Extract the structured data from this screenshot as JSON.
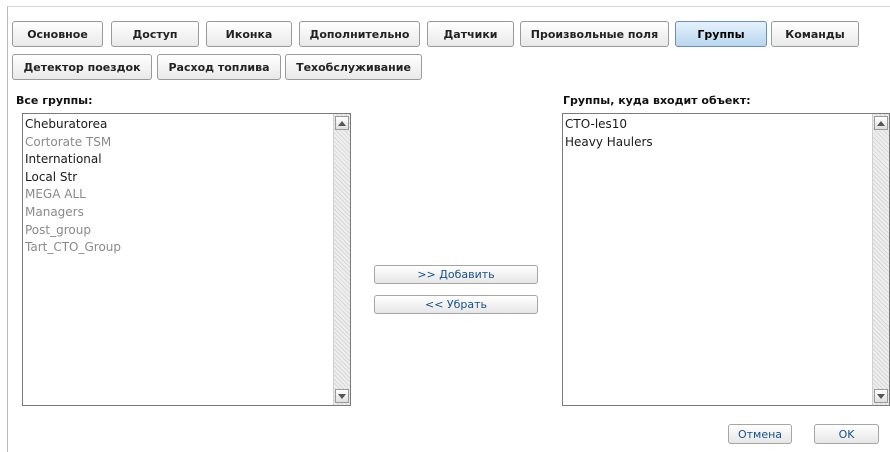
{
  "tabs": [
    {
      "label": "Основное"
    },
    {
      "label": "Доступ"
    },
    {
      "label": "Иконка"
    },
    {
      "label": "Дополнительно"
    },
    {
      "label": "Датчики"
    },
    {
      "label": "Произвольные поля"
    },
    {
      "label": "Группы",
      "active": true
    },
    {
      "label": "Команды"
    },
    {
      "label": "Детектор поездок"
    },
    {
      "label": "Расход топлива"
    },
    {
      "label": "Техобслуживание"
    }
  ],
  "all_groups": {
    "label": "Все группы:",
    "items": [
      {
        "name": "Cheburatorea",
        "style": "dark"
      },
      {
        "name": "Cortorate TSM",
        "style": "muted"
      },
      {
        "name": "International",
        "style": "dark"
      },
      {
        "name": "Local Str",
        "style": "dark"
      },
      {
        "name": "MEGA ALL",
        "style": "muted"
      },
      {
        "name": "Managers",
        "style": "muted"
      },
      {
        "name": "Post_group",
        "style": "muted"
      },
      {
        "name": "Tart_CTO_Group",
        "style": "muted"
      }
    ]
  },
  "object_groups": {
    "label": "Группы, куда входит объект:",
    "items": [
      {
        "name": "CTO-les10",
        "style": "dark"
      },
      {
        "name": "Heavy Haulers",
        "style": "dark"
      }
    ]
  },
  "actions": {
    "add_label": ">> Добавить",
    "remove_label": "<< Убрать"
  },
  "footer": {
    "cancel_label": "Отмена",
    "ok_label": "OK"
  },
  "colors": {
    "active_tab": "#b9d6ef",
    "button_text": "#1a4f8a",
    "muted_item": "#8a8a8a"
  }
}
